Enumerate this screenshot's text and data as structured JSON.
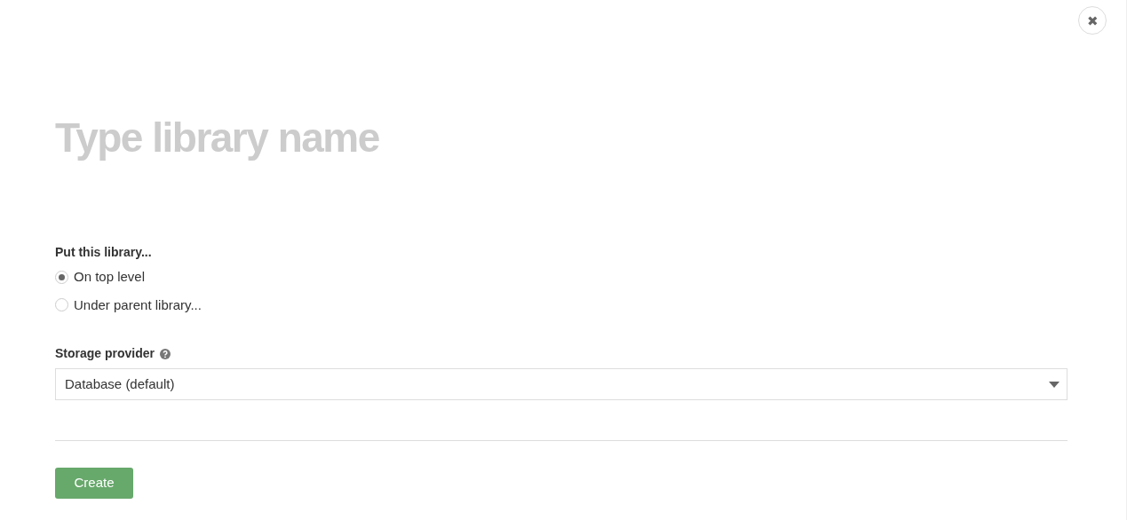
{
  "close_button": {
    "label": "✖"
  },
  "name_field": {
    "placeholder": "Type library name"
  },
  "placement": {
    "label": "Put this library...",
    "options": [
      {
        "label": "On top level",
        "selected": true
      },
      {
        "label": "Under parent library...",
        "selected": false
      }
    ]
  },
  "storage_provider": {
    "label": "Storage provider",
    "value": "Database (default)"
  },
  "buttons": [
    {
      "label": "Create"
    }
  ]
}
